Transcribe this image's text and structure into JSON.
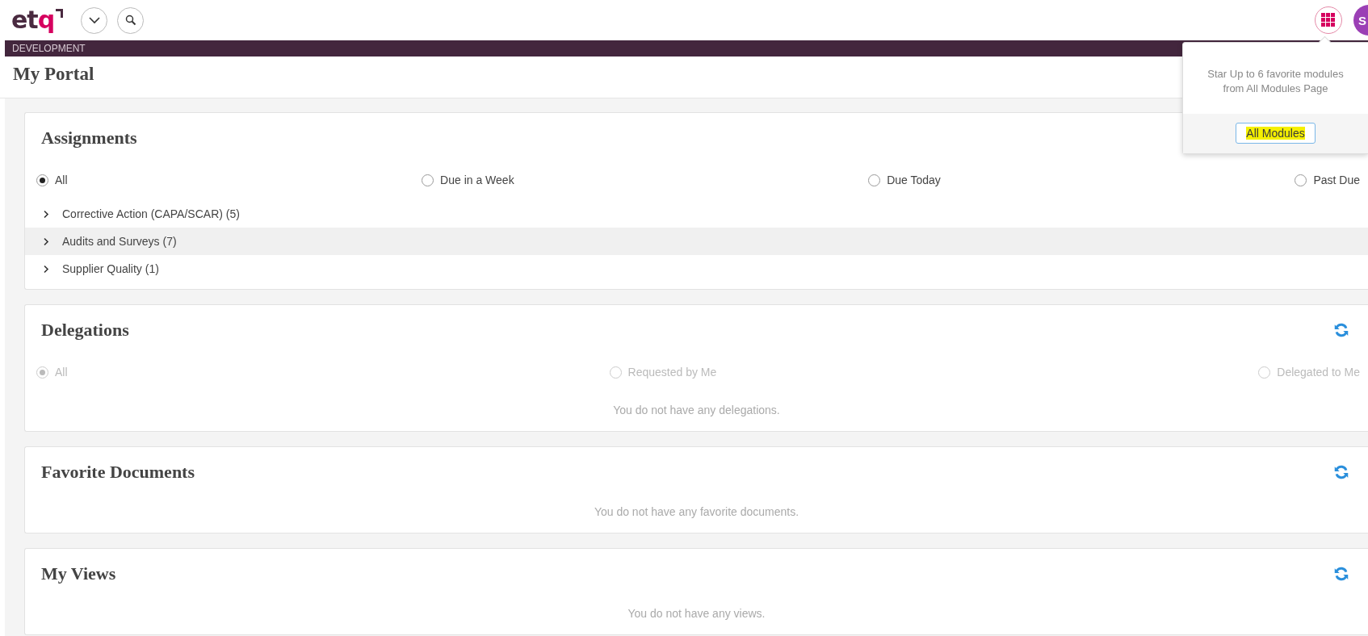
{
  "header": {
    "logo": "etq",
    "environment": "DEVELOPMENT",
    "avatar_initial": "S"
  },
  "page_title": "My Portal",
  "panels": [
    {
      "title": "Assignments",
      "filters": [
        {
          "label": "All",
          "selected": true,
          "disabled": false
        },
        {
          "label": "Due in a Week",
          "selected": false,
          "disabled": false
        },
        {
          "label": "Due Today",
          "selected": false,
          "disabled": false
        },
        {
          "label": "Past Due",
          "selected": false,
          "disabled": false
        }
      ],
      "groups": [
        {
          "label": "Corrective Action (CAPA/SCAR) (5)",
          "expanded": false,
          "highlighted": false
        },
        {
          "label": "Audits and Surveys (7)",
          "expanded": false,
          "highlighted": true
        },
        {
          "label": "Supplier Quality (1)",
          "expanded": false,
          "highlighted": false
        }
      ]
    },
    {
      "title": "Delegations",
      "refresh_icon": true,
      "filters": [
        {
          "label": "All",
          "selected": true,
          "disabled": true
        },
        {
          "label": "Requested by Me",
          "selected": false,
          "disabled": true
        },
        {
          "label": "Delegated to Me",
          "selected": false,
          "disabled": true
        }
      ],
      "empty_message": "You do not have any delegations."
    },
    {
      "title": "Favorite Documents",
      "refresh_icon": true,
      "empty_message": "You do not have any favorite documents."
    },
    {
      "title": "My Views",
      "refresh_icon": true,
      "empty_message": "You do not have any views."
    }
  ],
  "popover": {
    "message": "Star Up to 6 favorite modules from All Modules Page",
    "button": "All Modules",
    "button_highlighted": true
  }
}
